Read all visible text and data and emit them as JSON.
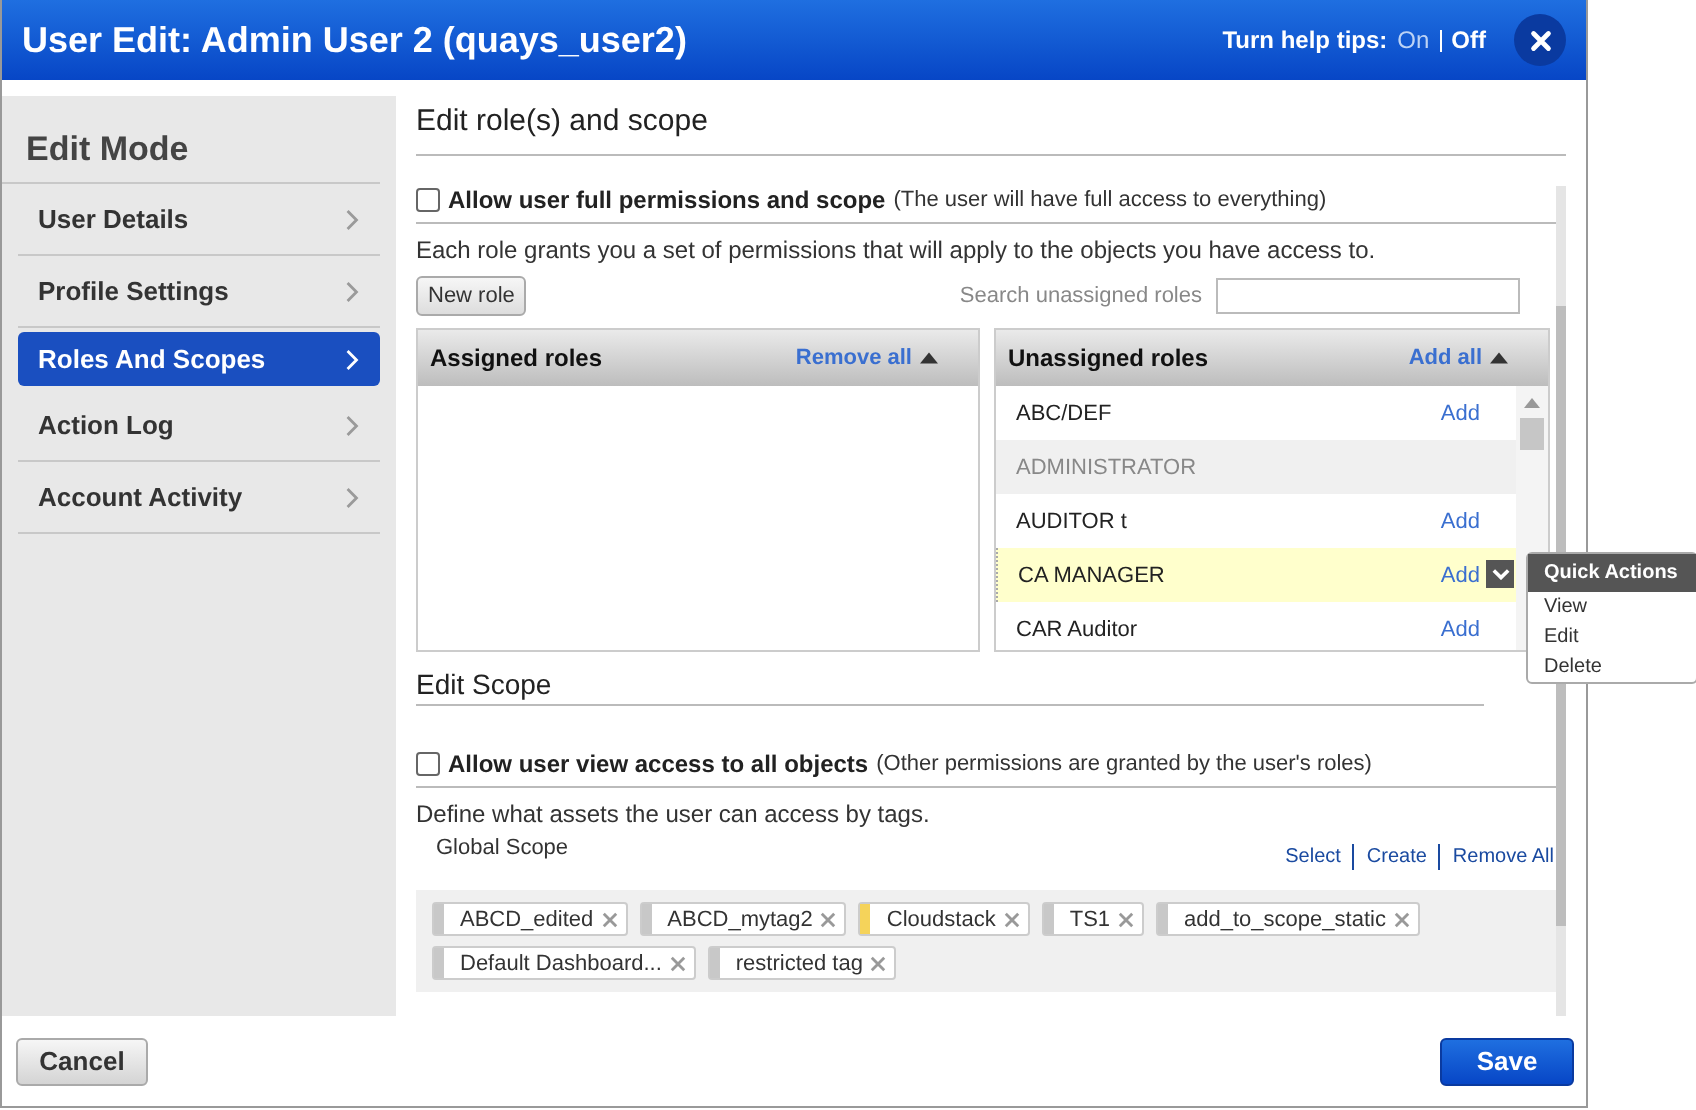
{
  "window": {
    "title": "User Edit: Admin User 2 (quays_user2)",
    "help_tips": {
      "label": "Turn help tips:",
      "options": [
        {
          "label": "On",
          "selected": false
        },
        {
          "label": "Off",
          "selected": true
        }
      ]
    }
  },
  "sidebar": {
    "title": "Edit Mode",
    "items": [
      {
        "label": "User Details",
        "selected": false
      },
      {
        "label": "Profile Settings",
        "selected": false
      },
      {
        "label": "Roles And Scopes",
        "selected": true
      },
      {
        "label": "Action Log",
        "selected": false
      },
      {
        "label": "Account Activity",
        "selected": false
      }
    ]
  },
  "roles": {
    "title": "Edit role(s) and scope",
    "full_permissions": {
      "label": "Allow user full permissions and scope",
      "note": "(The user will have full access to everything)",
      "checked": false
    },
    "description": "Each role grants you a set of permissions that will apply to the objects you have access to.",
    "new_role_button": "New role",
    "search": {
      "label": "Search unassigned roles"
    },
    "assigned": {
      "title": "Assigned roles",
      "action": "Remove all"
    },
    "unassigned": {
      "title": "Unassigned roles",
      "action": "Add all",
      "rows": [
        {
          "name": "ABC/DEF",
          "action": "Add",
          "disabled": false,
          "highlighted": false
        },
        {
          "name": "ADMINISTRATOR",
          "disabled": true,
          "highlighted": false
        },
        {
          "name": "AUDITOR t",
          "action": "Add",
          "disabled": false,
          "highlighted": false
        },
        {
          "name": "CA MANAGER",
          "action": "Add",
          "disabled": false,
          "highlighted": true
        },
        {
          "name": "CAR Auditor",
          "action": "Add",
          "disabled": false,
          "highlighted": false
        }
      ]
    },
    "quick_actions": {
      "title": "Quick Actions",
      "items": [
        "View",
        "Edit",
        "Delete"
      ]
    }
  },
  "scope": {
    "title": "Edit Scope",
    "view_all": {
      "label": "Allow user view access to all objects",
      "note": "(Other permissions are granted by the user's roles)",
      "checked": false
    },
    "description": "Define what assets the user can access by tags.",
    "global_scope": "Global Scope",
    "links": [
      "Select",
      "Create",
      "Remove All"
    ],
    "tags": [
      {
        "label": "ABCD_edited",
        "color": "#c8c8c8"
      },
      {
        "label": "ABCD_mytag2",
        "color": "#c8c8c8"
      },
      {
        "label": "Cloudstack",
        "color": "#f5d35a"
      },
      {
        "label": "TS1",
        "color": "#c8c8c8"
      },
      {
        "label": "add_to_scope_static",
        "color": "#c8c8c8"
      },
      {
        "label": "Default Dashboard...",
        "color": "#c8c8c8"
      },
      {
        "label": "restricted tag",
        "color": "#c8c8c8"
      }
    ]
  },
  "footer": {
    "cancel": "Cancel",
    "save": "Save"
  }
}
